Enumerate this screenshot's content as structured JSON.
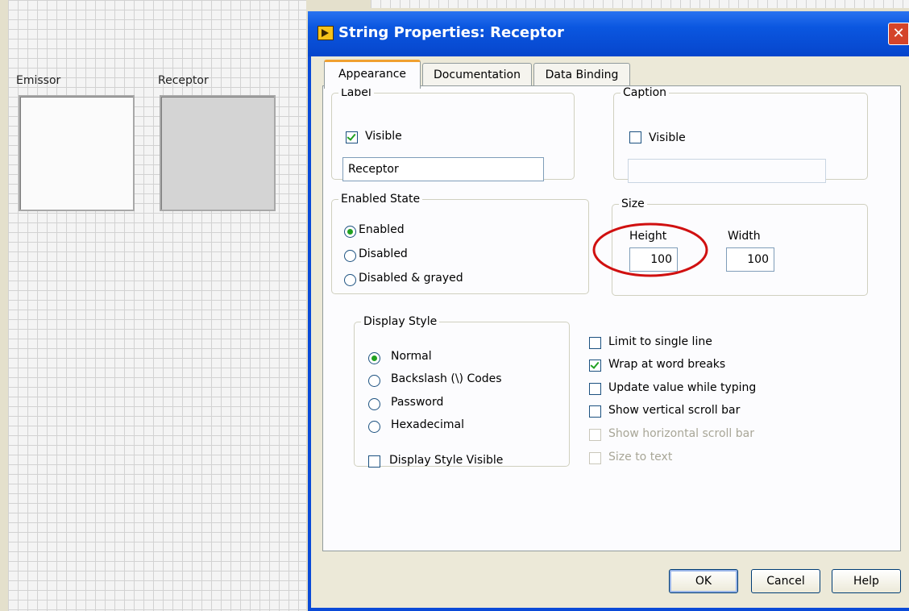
{
  "front_panel": {
    "controls": [
      {
        "label": "Emissor"
      },
      {
        "label": "Receptor"
      }
    ]
  },
  "dialog": {
    "title": "String Properties: Receptor",
    "close_glyph": "✕",
    "tabs": [
      "Appearance",
      "Documentation",
      "Data Binding"
    ],
    "active_tab": "Appearance",
    "label_group": {
      "legend": "Label",
      "visible_label": "Visible",
      "visible_checked": true,
      "value": "Receptor"
    },
    "caption_group": {
      "legend": "Caption",
      "visible_label": "Visible",
      "visible_checked": false,
      "value": ""
    },
    "enabled_state": {
      "legend": "Enabled State",
      "options": [
        "Enabled",
        "Disabled",
        "Disabled & grayed"
      ],
      "selected": "Enabled"
    },
    "size": {
      "legend": "Size",
      "height_label": "Height",
      "height_value": "100",
      "width_label": "Width",
      "width_value": "100"
    },
    "display_style": {
      "legend": "Display Style",
      "options": [
        "Normal",
        "Backslash (\\) Codes",
        "Password",
        "Hexadecimal"
      ],
      "selected": "Normal",
      "visible_label": "Display Style Visible",
      "visible_checked": false
    },
    "options": [
      {
        "label": "Limit to single line",
        "checked": false,
        "enabled": true
      },
      {
        "label": "Wrap at word breaks",
        "checked": true,
        "enabled": true
      },
      {
        "label": "Update value while typing",
        "checked": false,
        "enabled": true
      },
      {
        "label": "Show vertical scroll bar",
        "checked": false,
        "enabled": true
      },
      {
        "label": "Show horizontal scroll bar",
        "checked": false,
        "enabled": false
      },
      {
        "label": "Size to text",
        "checked": false,
        "enabled": false
      }
    ],
    "buttons": {
      "ok": "OK",
      "cancel": "Cancel",
      "help": "Help"
    },
    "annotation_color": "#d01010"
  }
}
